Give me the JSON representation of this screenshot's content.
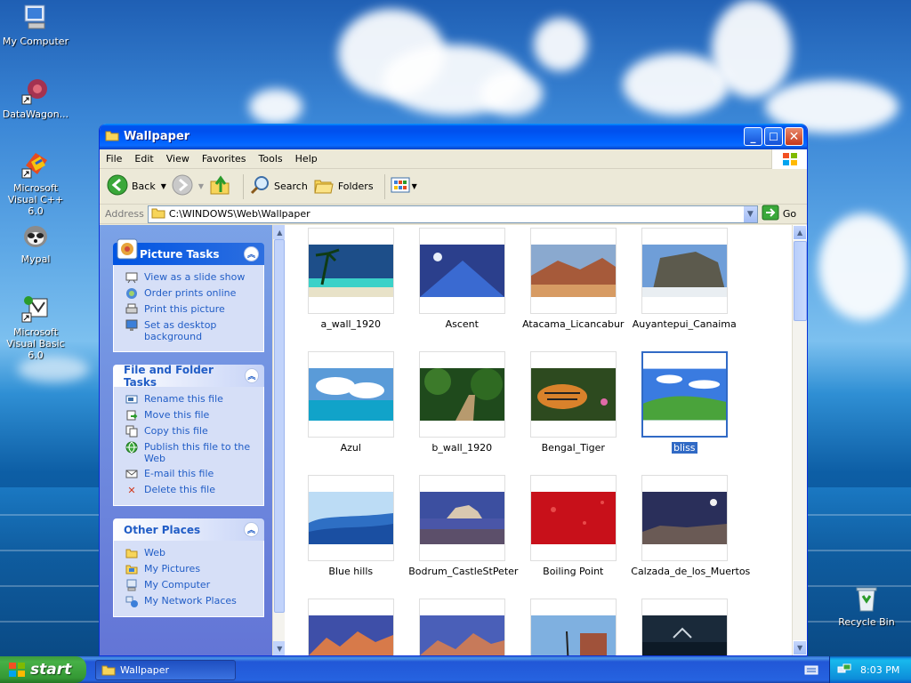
{
  "desktop": {
    "icons": [
      {
        "label": "My Computer",
        "icon": "my-computer-icon"
      },
      {
        "label": "DataWagon...",
        "icon": "datawagon-icon"
      },
      {
        "label": "Microsoft Visual C++ 6.0",
        "icon": "visual-cpp-icon"
      },
      {
        "label": "Mypal",
        "icon": "mypal-icon"
      },
      {
        "label": "Microsoft Visual Basic 6.0",
        "icon": "visual-basic-icon"
      },
      {
        "label": "Recycle Bin",
        "icon": "recycle-bin-icon"
      }
    ]
  },
  "window": {
    "title": "Wallpaper",
    "menu": [
      "File",
      "Edit",
      "View",
      "Favorites",
      "Tools",
      "Help"
    ],
    "toolbar": {
      "back": "Back",
      "search": "Search",
      "folders": "Folders"
    },
    "address": {
      "label": "Address",
      "value": "C:\\WINDOWS\\Web\\Wallpaper",
      "go": "Go"
    }
  },
  "taskpane": {
    "picture_tasks": {
      "title": "Picture Tasks",
      "items": [
        "View as a slide show",
        "Order prints online",
        "Print this picture",
        "Set as desktop background"
      ]
    },
    "file_tasks": {
      "title": "File and Folder Tasks",
      "items": [
        "Rename this file",
        "Move this file",
        "Copy this file",
        "Publish this file to the Web",
        "E-mail this file",
        "Delete this file"
      ]
    },
    "other_places": {
      "title": "Other Places",
      "items": [
        "Web",
        "My Pictures",
        "My Computer",
        "My Network Places"
      ]
    }
  },
  "files": [
    {
      "name": "a_wall_1920",
      "selected": false
    },
    {
      "name": "Ascent",
      "selected": false
    },
    {
      "name": "Atacama_Licancabur",
      "selected": false
    },
    {
      "name": "Auyantepui_Canaima",
      "selected": false
    },
    {
      "name": "Azul",
      "selected": false
    },
    {
      "name": "b_wall_1920",
      "selected": false
    },
    {
      "name": "Bengal_Tiger",
      "selected": false
    },
    {
      "name": "bliss",
      "selected": true
    },
    {
      "name": "Blue hills",
      "selected": false
    },
    {
      "name": "Bodrum_CastleStPeter",
      "selected": false
    },
    {
      "name": "Boiling Point",
      "selected": false
    },
    {
      "name": "Calzada_de_los_Muertos",
      "selected": false
    }
  ],
  "taskbar": {
    "start": "start",
    "window_button": "Wallpaper",
    "clock": "8:03 PM"
  },
  "colors": {
    "title_blue": "#0058ee",
    "link_blue": "#215dc6",
    "selection": "#316ac5",
    "start_green": "#3c9a3c"
  }
}
